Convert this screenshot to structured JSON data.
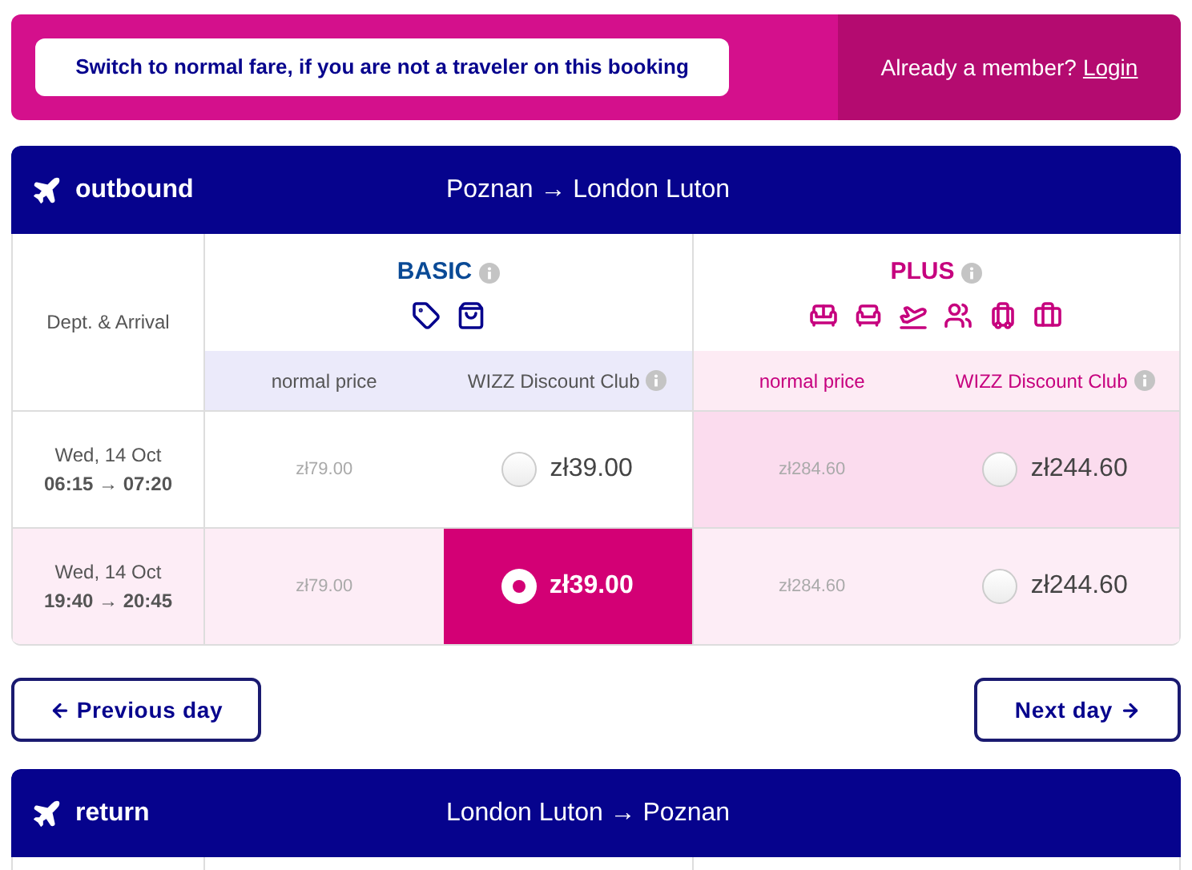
{
  "top_bar": {
    "switch_button": "Switch to normal fare, if you are not a traveler on this booking",
    "member_text": "Already a member?",
    "login_link": "Login"
  },
  "outbound": {
    "label": "outbound",
    "route": "Poznan → London Luton"
  },
  "table": {
    "first_column": "Dept. & Arrival",
    "fares": [
      {
        "name": "BASIC",
        "kind": "basic",
        "normal_label": "normal price",
        "club_label": "WIZZ Discount Club"
      },
      {
        "name": "PLUS",
        "kind": "plus",
        "normal_label": "normal price",
        "club_label": "WIZZ Discount Club"
      }
    ],
    "rows": [
      {
        "date": "Wed, 14 Oct",
        "times": "06:15 → 07:20",
        "highlighted": false,
        "prices": [
          {
            "normal": "zł79.00",
            "club": "zł39.00",
            "selected": false,
            "highlighted": false
          },
          {
            "normal": "zł284.60",
            "club": "zł244.60",
            "selected": false,
            "highlighted": true
          }
        ]
      },
      {
        "date": "Wed, 14 Oct",
        "times": "19:40 → 20:45",
        "highlighted": true,
        "prices": [
          {
            "normal": "zł79.00",
            "club": "zł39.00",
            "selected": true,
            "highlighted": false
          },
          {
            "normal": "zł284.60",
            "club": "zł244.60",
            "selected": false,
            "highlighted": false
          }
        ]
      }
    ]
  },
  "nav": {
    "previous": "Previous day",
    "next": "Next day"
  },
  "return": {
    "label": "return",
    "route": "London Luton → Poznan"
  }
}
